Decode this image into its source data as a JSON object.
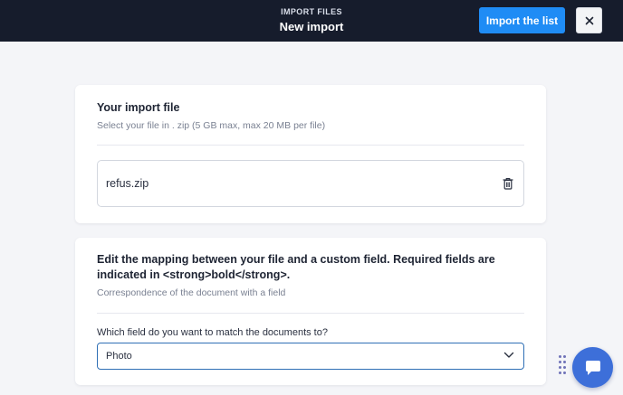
{
  "header": {
    "kicker": "IMPORT FILES",
    "title": "New import",
    "import_button": "Import the list",
    "close_icon": "close-icon"
  },
  "file_section": {
    "title": "Your import file",
    "subtitle": "Select your file in . zip (5 GB max, max 20 MB per file)",
    "file_name": "refus.zip",
    "delete_icon": "trash-icon"
  },
  "mapping_section": {
    "title": "Edit the mapping between your file and a custom field. Required fields are indicated in <strong>bold</strong>.",
    "subtitle": "Correspondence of the document with a field",
    "field_label": "Which field do you want to match the documents to?",
    "selected_value": "Photo",
    "chevron_icon": "chevron-down-icon"
  },
  "widgets": {
    "grip_icon": "drag-handle-icon",
    "chat_icon": "chat-bubble-icon"
  },
  "colors": {
    "header_bg": "#161c2c",
    "accent": "#1f8cf5",
    "select_border": "#2f6fb5",
    "chat_bg": "#3d6fd9"
  }
}
